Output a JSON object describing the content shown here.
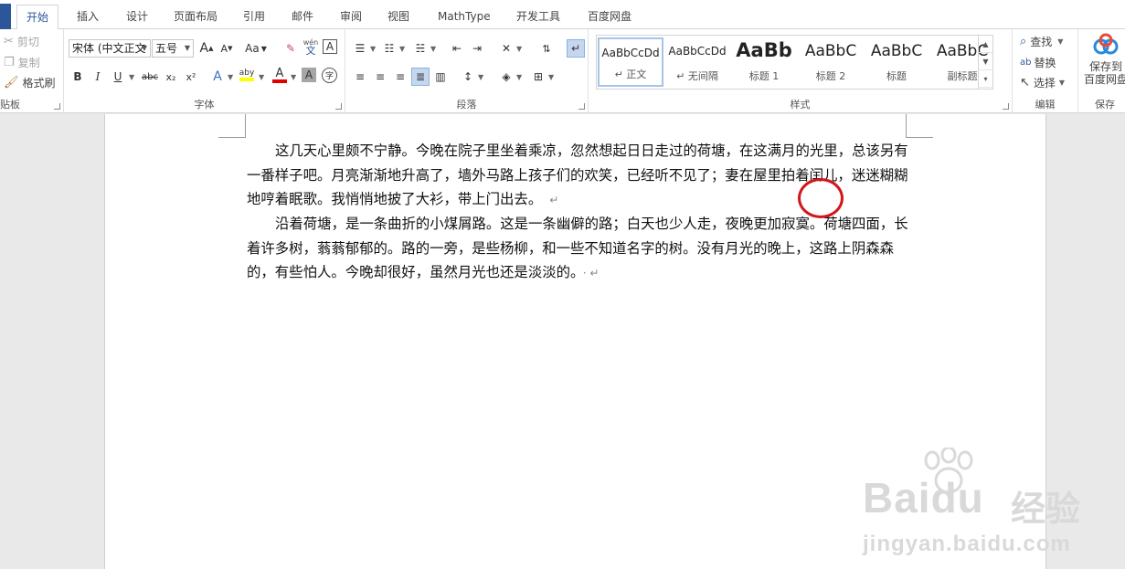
{
  "tabs": [
    "开始",
    "插入",
    "设计",
    "页面布局",
    "引用",
    "邮件",
    "审阅",
    "视图",
    "MathType",
    "开发工具",
    "百度网盘"
  ],
  "clipboard": {
    "cut": "剪切",
    "copy": "复制",
    "format_painter": "格式刷",
    "label": "贴板"
  },
  "font": {
    "name": "宋体 (中文正文",
    "size": "五号",
    "grow": "A",
    "shrink": "A",
    "case": "Aa",
    "wen": "wén",
    "wen_sub": "文",
    "border_a": "A",
    "bold": "B",
    "italic": "I",
    "underline": "U",
    "strike": "abc",
    "subscript": "x₂",
    "superscript": "x²",
    "effects": "A",
    "highlight": "aby",
    "color": "A",
    "shade": "A",
    "enclose": "字",
    "label": "字体"
  },
  "paragraph": {
    "label": "段落"
  },
  "styles": {
    "items": [
      {
        "sample": "AaBbCcDd",
        "name": "↵ 正文"
      },
      {
        "sample": "AaBbCcDd",
        "name": "↵ 无间隔"
      },
      {
        "sample": "AaBb",
        "name": "标题 1"
      },
      {
        "sample": "AaBbC",
        "name": "标题 2"
      },
      {
        "sample": "AaBbC",
        "name": "标题"
      },
      {
        "sample": "AaBbC",
        "name": "副标题"
      }
    ],
    "label": "样式"
  },
  "editing": {
    "find": "查找",
    "replace": "替换",
    "select": "选择",
    "label": "编辑"
  },
  "save": {
    "line1": "保存到",
    "line2": "百度网盘",
    "label": "保存"
  },
  "document": {
    "paragraphs": [
      {
        "lines": [
          "这几天心里颇不宁静。今晚在院子里坐着乘凉，忽然想起日日走过的荷塘，在这满月的",
          "光里，总该另有一番样子吧。月亮渐渐地升高了，墙外马路上孩子们的欢笑，已经听不见了；",
          "妻在屋里拍着闰儿，迷迷糊糊地哼着眠歌。我悄悄地披了大衫，带上门出去。"
        ],
        "end_mark": "↵"
      },
      {
        "lines": [
          "沿着荷塘，是一条曲折的小煤屑路。这是一条幽僻的路；白天也少人走，夜晚更加寂寞。",
          "荷塘四面，长着许多树，蓊蓊郁郁的。路的一旁，是些杨柳，和一些不知道名字的树。没有",
          "月光的晚上，这路上阴森森的，有些怕人。今晚却很好，虽然月光也还是淡淡的。"
        ],
        "end_mark": "· ↵"
      }
    ]
  },
  "watermark": {
    "brand": "Baidu",
    "brand_cn": "经验",
    "domain": "jingyan.baidu.com"
  },
  "colors": {
    "accent": "#2b579a",
    "highlight_yellow": "#ffff00",
    "font_red": "#e00000",
    "circle_red": "#d2171a"
  }
}
